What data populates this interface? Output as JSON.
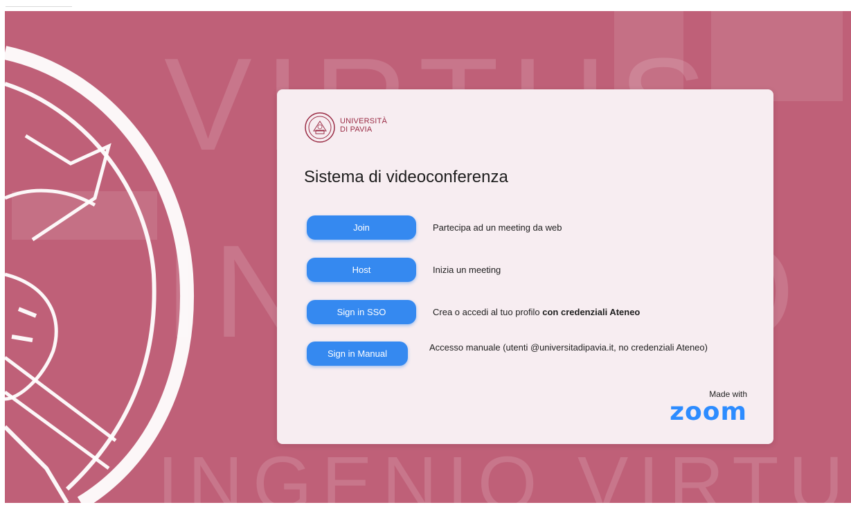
{
  "card": {
    "logo": {
      "line1": "UNIVERSITÀ",
      "line2": "DI PAVIA"
    },
    "title": "Sistema di videoconferenza",
    "actions": [
      {
        "label": "Join",
        "description": "Partecipa ad un meeting da web"
      },
      {
        "label": "Host",
        "description": "Inizia un meeting"
      },
      {
        "label": "Sign in SSO",
        "description_prefix": "Crea o accedi al tuo profilo ",
        "description_bold": "con credenziali Ateneo"
      },
      {
        "label": "Sign in Manual",
        "description": "Accesso manuale (utenti @universitadipavia.it, no credenziali Ateneo)"
      }
    ],
    "footer": {
      "made_with": "Made with",
      "brand": "zoom"
    }
  },
  "colors": {
    "background": "#bf6078",
    "card": "#f7edf1",
    "button": "#3589f0",
    "zoom_brand": "#2d8cff",
    "university_red": "#9a2c45"
  },
  "background_watermark": [
    "VIRTUS",
    "INGENIO",
    "VIRTUS"
  ]
}
